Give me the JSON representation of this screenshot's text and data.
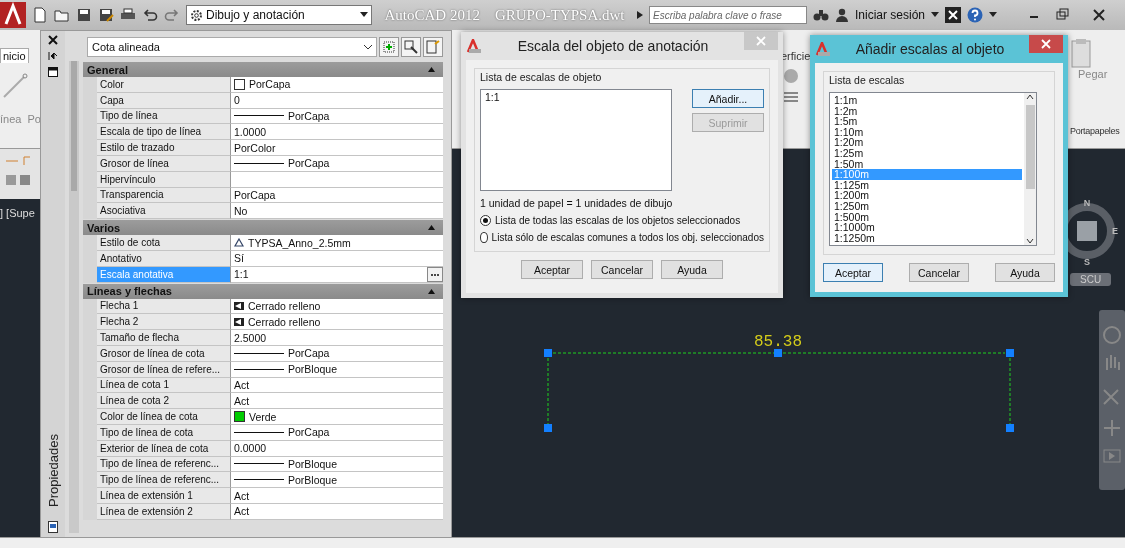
{
  "title_bar": {
    "workspace": "Dibujo y anotación",
    "title": "AutoCAD 2012    GRUPO-TYPSA.dwt",
    "search": {
      "placeholder": "Escriba palabra clave o frase"
    },
    "sign_in": "Iniciar sesión"
  },
  "ribbon": {
    "tab": "nicio",
    "left_labels": [
      "ínea",
      "Po"
    ],
    "middle_label": "erficie",
    "right_button": "Pegar",
    "right_panel": "Portapapeles"
  },
  "viewport_label": "] [Supe",
  "properties": {
    "title": "Propiedades",
    "object": "Cota alineada",
    "sections": [
      {
        "name": "General",
        "expanded": true,
        "rows": [
          {
            "label": "Color",
            "kind": "swatch",
            "color": "#ffffff",
            "value": "PorCapa",
            "selected": false
          },
          {
            "label": "Capa",
            "kind": "text",
            "value": "0",
            "selected": false
          },
          {
            "label": "Tipo de línea",
            "kind": "line",
            "value": "PorCapa",
            "selected": false
          },
          {
            "label": "Escala de tipo de línea",
            "kind": "text",
            "value": "1.0000",
            "selected": false
          },
          {
            "label": "Estilo de trazado",
            "kind": "text",
            "value": "PorColor",
            "selected": false
          },
          {
            "label": "Grosor de línea",
            "kind": "line",
            "value": "PorCapa",
            "selected": false
          },
          {
            "label": "Hipervínculo",
            "kind": "text",
            "selected": false
          },
          {
            "label": "Transparencia",
            "kind": "text",
            "value": "PorCapa",
            "selected": false
          },
          {
            "label": "Asociativa",
            "kind": "text",
            "value": "No",
            "selected": false
          }
        ]
      },
      {
        "name": "Varios",
        "expanded": true,
        "rows": [
          {
            "label": "Estilo de cota",
            "kind": "style",
            "value": "TYPSA_Anno_2.5mm",
            "selected": false
          },
          {
            "label": "Anotativo",
            "kind": "text",
            "value": "Sí",
            "selected": false
          },
          {
            "label": "Escala anotativa",
            "kind": "text",
            "value": "1:1",
            "selected": true
          }
        ]
      },
      {
        "name": "Líneas y flechas",
        "expanded": true,
        "rows": [
          {
            "label": "Flecha 1",
            "kind": "arrow",
            "value": "Cerrado relleno",
            "selected": false
          },
          {
            "label": "Flecha 2",
            "kind": "arrow",
            "value": "Cerrado relleno",
            "selected": false
          },
          {
            "label": "Tamaño de flecha",
            "kind": "text",
            "value": "2.5000",
            "selected": false
          },
          {
            "label": "Grosor de línea de cota",
            "kind": "line",
            "value": "PorCapa",
            "selected": false
          },
          {
            "label": "Grosor de línea de refere...",
            "kind": "line",
            "value": "PorBloque",
            "selected": false
          },
          {
            "label": "Línea de cota 1",
            "kind": "text",
            "value": "Act",
            "selected": false
          },
          {
            "label": "Línea de cota 2",
            "kind": "text",
            "value": "Act",
            "selected": false
          },
          {
            "label": "Color de línea de cota",
            "kind": "swatch",
            "color": "#00cc00",
            "value": "Verde",
            "selected": false
          },
          {
            "label": "Tipo de línea de cota",
            "kind": "line",
            "value": "PorCapa",
            "selected": false
          },
          {
            "label": "Exterior de línea de cota",
            "kind": "text",
            "value": "0.0000",
            "selected": false
          },
          {
            "label": "Tipo de línea de referenc...",
            "kind": "line",
            "value": "PorBloque",
            "selected": false
          },
          {
            "label": "Tipo de línea de referenc...",
            "kind": "line",
            "value": "PorBloque",
            "selected": false
          },
          {
            "label": "Línea de extensión 1",
            "kind": "text",
            "value": "Act",
            "selected": false
          },
          {
            "label": "Línea de extensión 2",
            "kind": "text",
            "value": "Act",
            "selected": false
          }
        ]
      }
    ]
  },
  "scale_dialog": {
    "title": "Escala del objeto de anotación",
    "group": "Lista de escalas de objeto",
    "scales": [
      {
        "label": "1:1",
        "selected": false
      }
    ],
    "side_buttons": [
      {
        "label": "Añadir...",
        "disabled": false,
        "focused": true
      },
      {
        "label": "Suprimir",
        "disabled": true,
        "focused": false
      }
    ],
    "ratio": "1 unidad de papel = 1 unidades de dibujo",
    "options": [
      {
        "label": "Lista de todas las escalas de los objetos seleccionados",
        "selected": true
      },
      {
        "label": "Lista sólo de escalas comunes a todos los obj. seleccionados",
        "selected": false
      }
    ],
    "buttons": [
      {
        "label": "Aceptar",
        "default": false
      },
      {
        "label": "Cancelar",
        "default": false
      },
      {
        "label": "Ayuda",
        "default": false
      }
    ]
  },
  "add_dialog": {
    "title": "Añadir escalas al objeto",
    "group": "Lista de escalas",
    "scales": [
      {
        "label": "1:1m",
        "selected": false
      },
      {
        "label": "1:2m",
        "selected": false
      },
      {
        "label": "1:5m",
        "selected": false
      },
      {
        "label": "1:10m",
        "selected": false
      },
      {
        "label": "1:20m",
        "selected": false
      },
      {
        "label": "1:25m",
        "selected": false
      },
      {
        "label": "1:50m",
        "selected": false
      },
      {
        "label": "1:100m",
        "selected": true
      },
      {
        "label": "1:125m",
        "selected": false
      },
      {
        "label": "1:200m",
        "selected": false
      },
      {
        "label": "1:250m",
        "selected": false
      },
      {
        "label": "1:500m",
        "selected": false
      },
      {
        "label": "1:1000m",
        "selected": false
      },
      {
        "label": "1:1250m",
        "selected": false
      }
    ],
    "buttons": [
      {
        "label": "Aceptar",
        "default": true
      },
      {
        "label": "Cancelar",
        "default": false
      },
      {
        "label": "Ayuda",
        "default": false
      }
    ]
  },
  "canvas": {
    "dimension": "85.38",
    "viewcube": {
      "north": "N",
      "east": "E",
      "south": "S",
      "ucs": "SCU"
    }
  }
}
